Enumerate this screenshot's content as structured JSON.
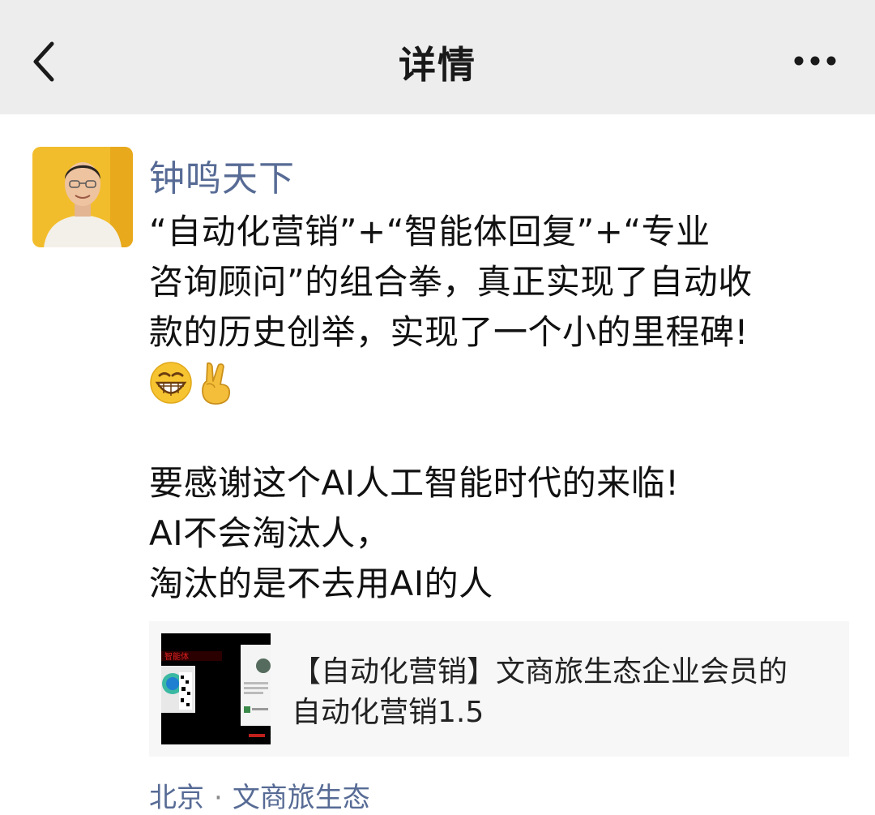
{
  "header": {
    "title": "详情",
    "back_icon": "chevron-left-icon",
    "more_icon": "more-dots-icon"
  },
  "post": {
    "author": "钟鸣天下",
    "lines": [
      "“自动化营销”+“智能体回复”+“专业",
      "咨询顾问”的组合拳，真正实现了自动收",
      "款的历史创举，实现了一个小的里程碑!"
    ],
    "emojis": [
      "😁",
      "✌️"
    ],
    "lines2": [
      "要感谢这个AI人工智能时代的来临!",
      "AI不会淘汰人，",
      "淘汰的是不去用AI的人"
    ]
  },
  "shared_card": {
    "title_line1": "【自动化营销】文商旅生态企业会员的",
    "title_line2": "自动化营销1.5",
    "thumb_text": "智能体"
  },
  "location": {
    "city": "北京",
    "tag": "文商旅生态"
  },
  "colors": {
    "link": "#576b95",
    "header_bg": "#ededed",
    "card_bg": "#f7f7f7"
  }
}
